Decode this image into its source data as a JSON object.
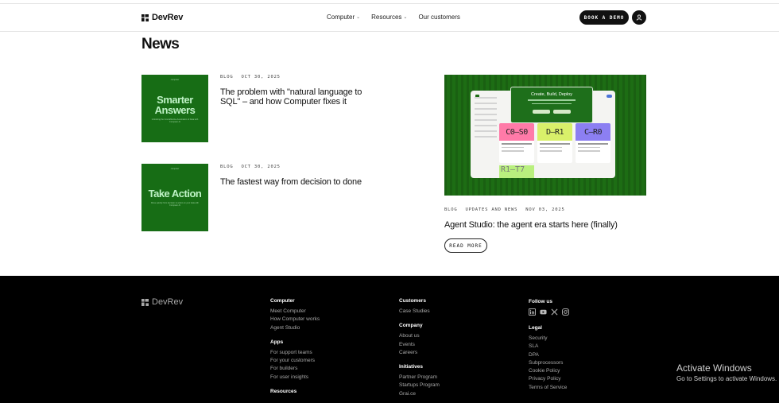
{
  "brand": {
    "name": "DevRev"
  },
  "nav": {
    "items": [
      {
        "label": "Computer",
        "has_dropdown": true
      },
      {
        "label": "Resources",
        "has_dropdown": true
      },
      {
        "label": "Our customers",
        "has_dropdown": false
      }
    ],
    "cta_label": "BOOK A DEMO"
  },
  "page": {
    "title": "News"
  },
  "articles": [
    {
      "category": "BLOG",
      "date": "OCT 30, 2025",
      "title": "The problem with \"natural language to SQL\" – and how Computer fixes it",
      "thumb_text": "Smarter Answers",
      "thumb_top": "computer",
      "thumb_sub": "Unlocking the Cost-Effective Automation of Data with Computer AI"
    },
    {
      "category": "BLOG",
      "date": "OCT 30, 2025",
      "title": "The fastest way from decision to done",
      "thumb_text": "Take Action",
      "thumb_top": "computer",
      "thumb_sub": "Move quickly from decision to action on your data with Computer AI"
    }
  ],
  "featured": {
    "category": "BLOG",
    "tag": "UPDATES AND NEWS",
    "date": "NOV 03, 2025",
    "title": "Agent Studio: the agent era starts here (finally)",
    "read_more": "READ MORE",
    "image": {
      "dialog_title": "Create, Build, Deploy",
      "cards": [
        {
          "code": "C0—S0",
          "label": "Customer Support Agent"
        },
        {
          "code": "D—R1",
          "label": "Design Reviewer"
        },
        {
          "code": "C—R0",
          "label": "Code Reviewer"
        }
      ],
      "fourth_card_code": "R1—T7"
    }
  },
  "footer": {
    "brand": "DevRev",
    "col1": {
      "groups": [
        {
          "heading": "Computer",
          "items": [
            "Meet Computer",
            "How Computer works",
            "Agent Studio"
          ]
        },
        {
          "heading": "Apps",
          "items": [
            "For support teams",
            "For your customers",
            "For builders",
            "For user insights"
          ]
        },
        {
          "heading": "Resources",
          "items": []
        }
      ]
    },
    "col2": {
      "groups": [
        {
          "heading": "Customers",
          "items": [
            "Case Studies"
          ]
        },
        {
          "heading": "Company",
          "items": [
            "About us",
            "Events",
            "Careers"
          ]
        },
        {
          "heading": "Initiatives",
          "items": [
            "Partner Program",
            "Startups Program",
            "Grai.ce"
          ]
        }
      ]
    },
    "col3": {
      "follow_heading": "Follow us",
      "social": [
        "linkedin-icon",
        "youtube-icon",
        "x-icon",
        "instagram-icon"
      ],
      "legal_heading": "Legal",
      "legal_items": [
        "Security",
        "SLA",
        "DPA",
        "Subprocessors",
        "Cookie Policy",
        "Privacy Policy",
        "Terms of Service"
      ]
    }
  },
  "watermark": {
    "line1": "Activate Windows",
    "line2": "Go to Settings to activate Windows."
  },
  "colors": {
    "green": "#176d15",
    "black": "#000000"
  }
}
